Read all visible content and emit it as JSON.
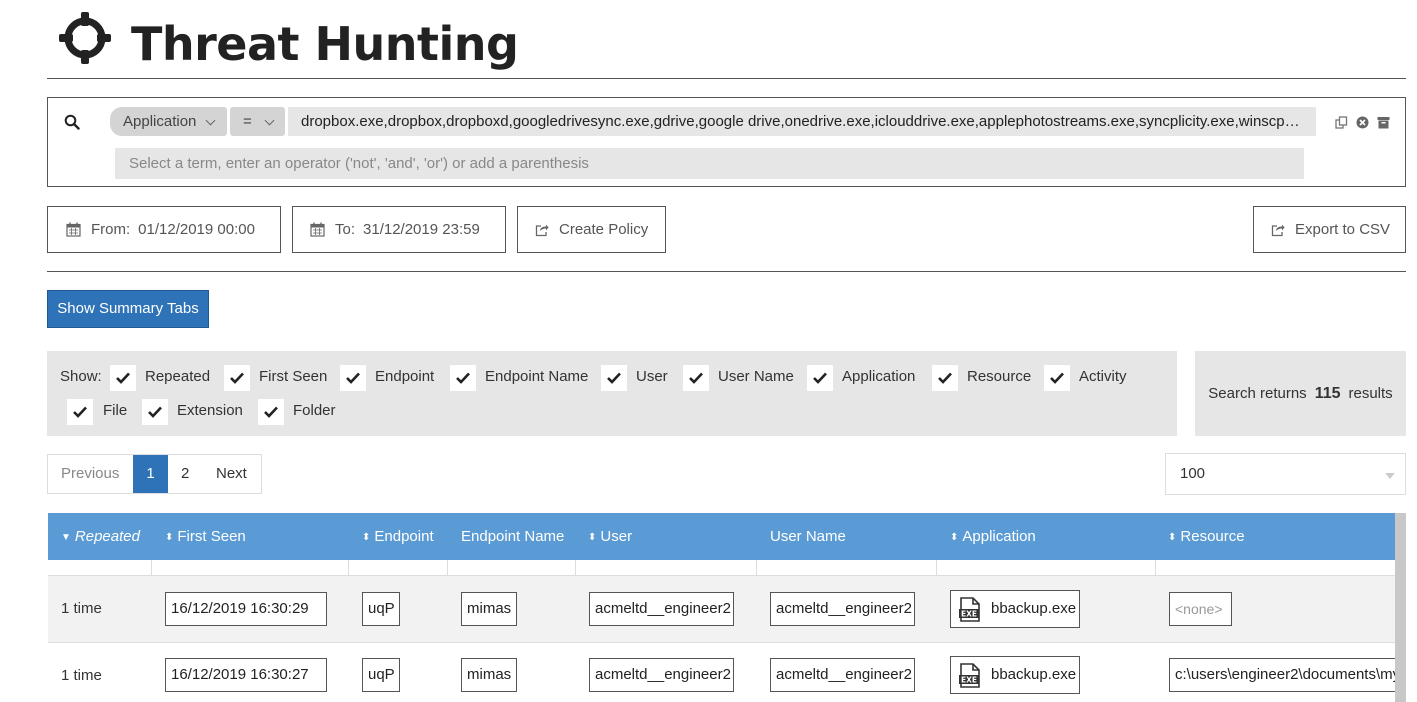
{
  "header": {
    "title": "Threat Hunting",
    "icon": "crosshair-icon"
  },
  "search": {
    "term_field": "Application",
    "operator": "=",
    "value": "dropbox.exe,dropbox,dropboxd,googledrivesync.exe,gdrive,google drive,onedrive.exe,iclouddrive.exe,applephotostreams.exe,syncplicity.exe,winscp.exe,ftp.exe,filezilla.exe",
    "placeholder": "Select a term, enter an operator ('not', 'and', 'or') or add a parenthesis"
  },
  "toolbar": {
    "from_label": "From:",
    "from_value": "01/12/2019 00:00",
    "to_label": "To:",
    "to_value": "31/12/2019 23:59",
    "create_policy": "Create Policy",
    "export_csv": "Export to CSV",
    "show_summary": "Show Summary Tabs"
  },
  "show": {
    "label": "Show:",
    "options": [
      "Repeated",
      "First Seen",
      "Endpoint",
      "Endpoint Name",
      "User",
      "User Name",
      "Application",
      "Resource",
      "Activity",
      "File",
      "Extension",
      "Folder"
    ]
  },
  "results": {
    "prefix": "Search returns",
    "count": "115",
    "suffix": "results"
  },
  "pagination": {
    "previous": "Previous",
    "pages": [
      "1",
      "2"
    ],
    "next": "Next",
    "page_size": "100"
  },
  "table": {
    "columns": [
      "Repeated",
      "First Seen",
      "Endpoint",
      "Endpoint Name",
      "User",
      "User Name",
      "Application",
      "Resource"
    ],
    "rows": [
      {
        "repeated": "1 time",
        "first_seen": "16/12/2019 16:30:29",
        "endpoint": "uqP",
        "endpoint_name": "mimas",
        "user": "acmeltd__engineer2",
        "user_name": "acmeltd__engineer2",
        "application": "bbackup.exe",
        "resource": "<none>"
      },
      {
        "repeated": "1 time",
        "first_seen": "16/12/2019 16:30:27",
        "endpoint": "uqP",
        "endpoint_name": "mimas",
        "user": "acmeltd__engineer2",
        "user_name": "acmeltd__engineer2",
        "application": "bbackup.exe",
        "resource": "c:\\users\\engineer2\\documents\\my"
      }
    ]
  },
  "colors": {
    "accent": "#2e72b8",
    "table_header": "#5b9bd5",
    "panel": "#e6e6e6"
  }
}
